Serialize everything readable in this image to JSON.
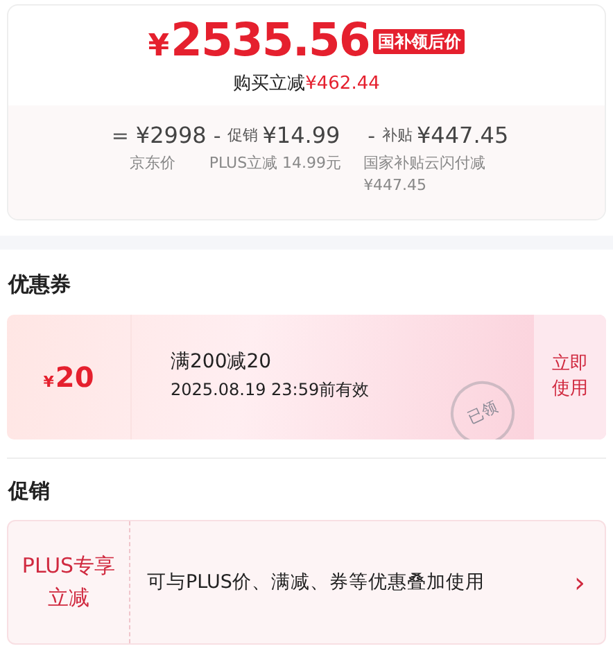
{
  "price": {
    "currency": "¥",
    "amount": "2535.56",
    "tag": "国补领后价",
    "saving_label": "购买立减",
    "saving_amount": "¥462.44"
  },
  "breakdown": [
    {
      "operator": "=",
      "amount": "¥2998",
      "note": "京东价"
    },
    {
      "operator": "-",
      "label": "促销",
      "amount": "¥14.99",
      "note": "PLUS立减 14.99元"
    },
    {
      "operator": "-",
      "label": "补贴",
      "amount": "¥447.45",
      "note": "国家补贴云闪付减 ¥447.45"
    }
  ],
  "coupons": {
    "title": "优惠券",
    "items": [
      {
        "currency": "¥",
        "amount": "20",
        "condition": "满200减20",
        "validity": "2025.08.19 23:59前有效",
        "stamp": "已领",
        "action": "立即使用"
      }
    ]
  },
  "promotions": {
    "title": "促销",
    "items": [
      {
        "tag": "PLUS专享立减",
        "description": "可与PLUS价、满减、券等优惠叠加使用",
        "chevron": "›"
      }
    ]
  }
}
